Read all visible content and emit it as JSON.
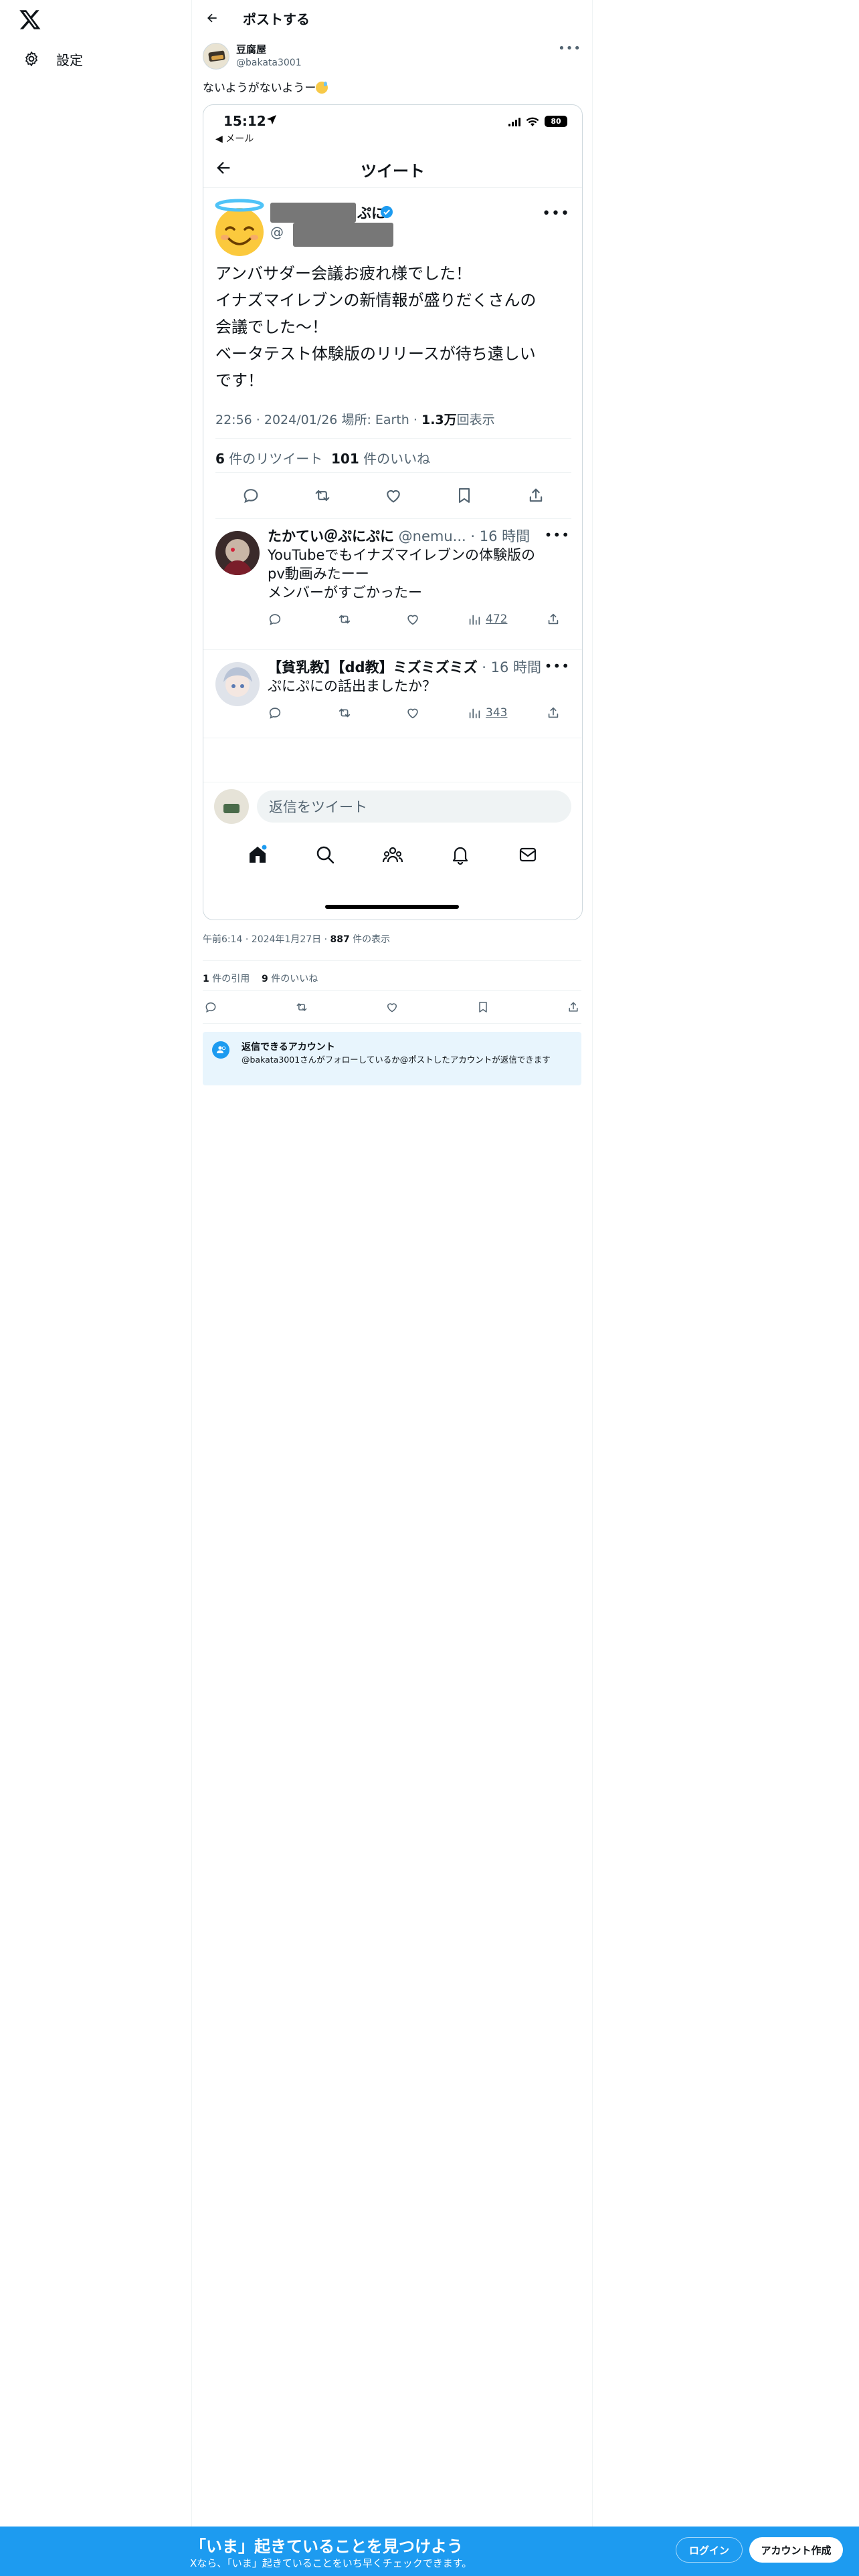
{
  "nav": {
    "settings_label": "設定"
  },
  "topbar": {
    "title": "ポストする"
  },
  "post": {
    "author_name": "豆腐屋",
    "author_handle": "@bakata3001",
    "text": "ないようがないようー",
    "timestamp": "午前6:14 · 2024年1月27日",
    "views_count": "887",
    "views_label": " 件の表示",
    "quotes_count": "1",
    "quotes_label": " 件の引用",
    "likes_count": "9",
    "likes_label": " 件のいいね"
  },
  "embed": {
    "time": "15:12",
    "back_app": "◀ メール",
    "battery": "80",
    "nav_title": "ツイート",
    "name_tail": "ぷに",
    "handle_prefix": "@",
    "text_lines": [
      "アンバサダー会議お疲れ様でした！",
      "イナズマイレブンの新情報が盛りだくさんの",
      "会議でした〜！",
      "ベータテスト体験版のリリースが待ち遠しい",
      "です！"
    ],
    "meta_time": "22:56 · 2024/01/26 ",
    "meta_location": "場所: Earth",
    "meta_views_count": "1.3万",
    "meta_views_label": "回表示",
    "retweets_count": "6",
    "retweets_label": "件のリツイート",
    "likes_count": "101",
    "likes_label": "件のいいね",
    "replies": [
      {
        "name": "たかてい＠ぷにぷに",
        "meta": " @nemu... · 16 時間",
        "body_lines": [
          "YouTubeでもイナズマイレブンの体験版の",
          "pv動画みたーー",
          "メンバーがすごかったー"
        ],
        "views": "472"
      },
      {
        "name": "【貧乳教】【dd教】ミズミズミズ",
        "meta": " · 16 時間",
        "body_lines": [
          "ぷにぷにの話出ましたか？"
        ],
        "views": "343"
      }
    ],
    "reply_placeholder": "返信をツイート"
  },
  "reply_restriction": {
    "title": "返信できるアカウント",
    "description": "@bakata3001さんがフォローしているか@ポストしたアカウントが返信できます"
  },
  "banner": {
    "title": "「いま」起きていることを見つけよう",
    "subtitle": "Xなら、「いま」起きていることをいち早くチェックできます。",
    "login_label": "ログイン",
    "signup_label": "アカウント作成"
  },
  "colors": {
    "accent": "#1d9bf0",
    "text": "#0f1419",
    "muted": "#536471"
  }
}
